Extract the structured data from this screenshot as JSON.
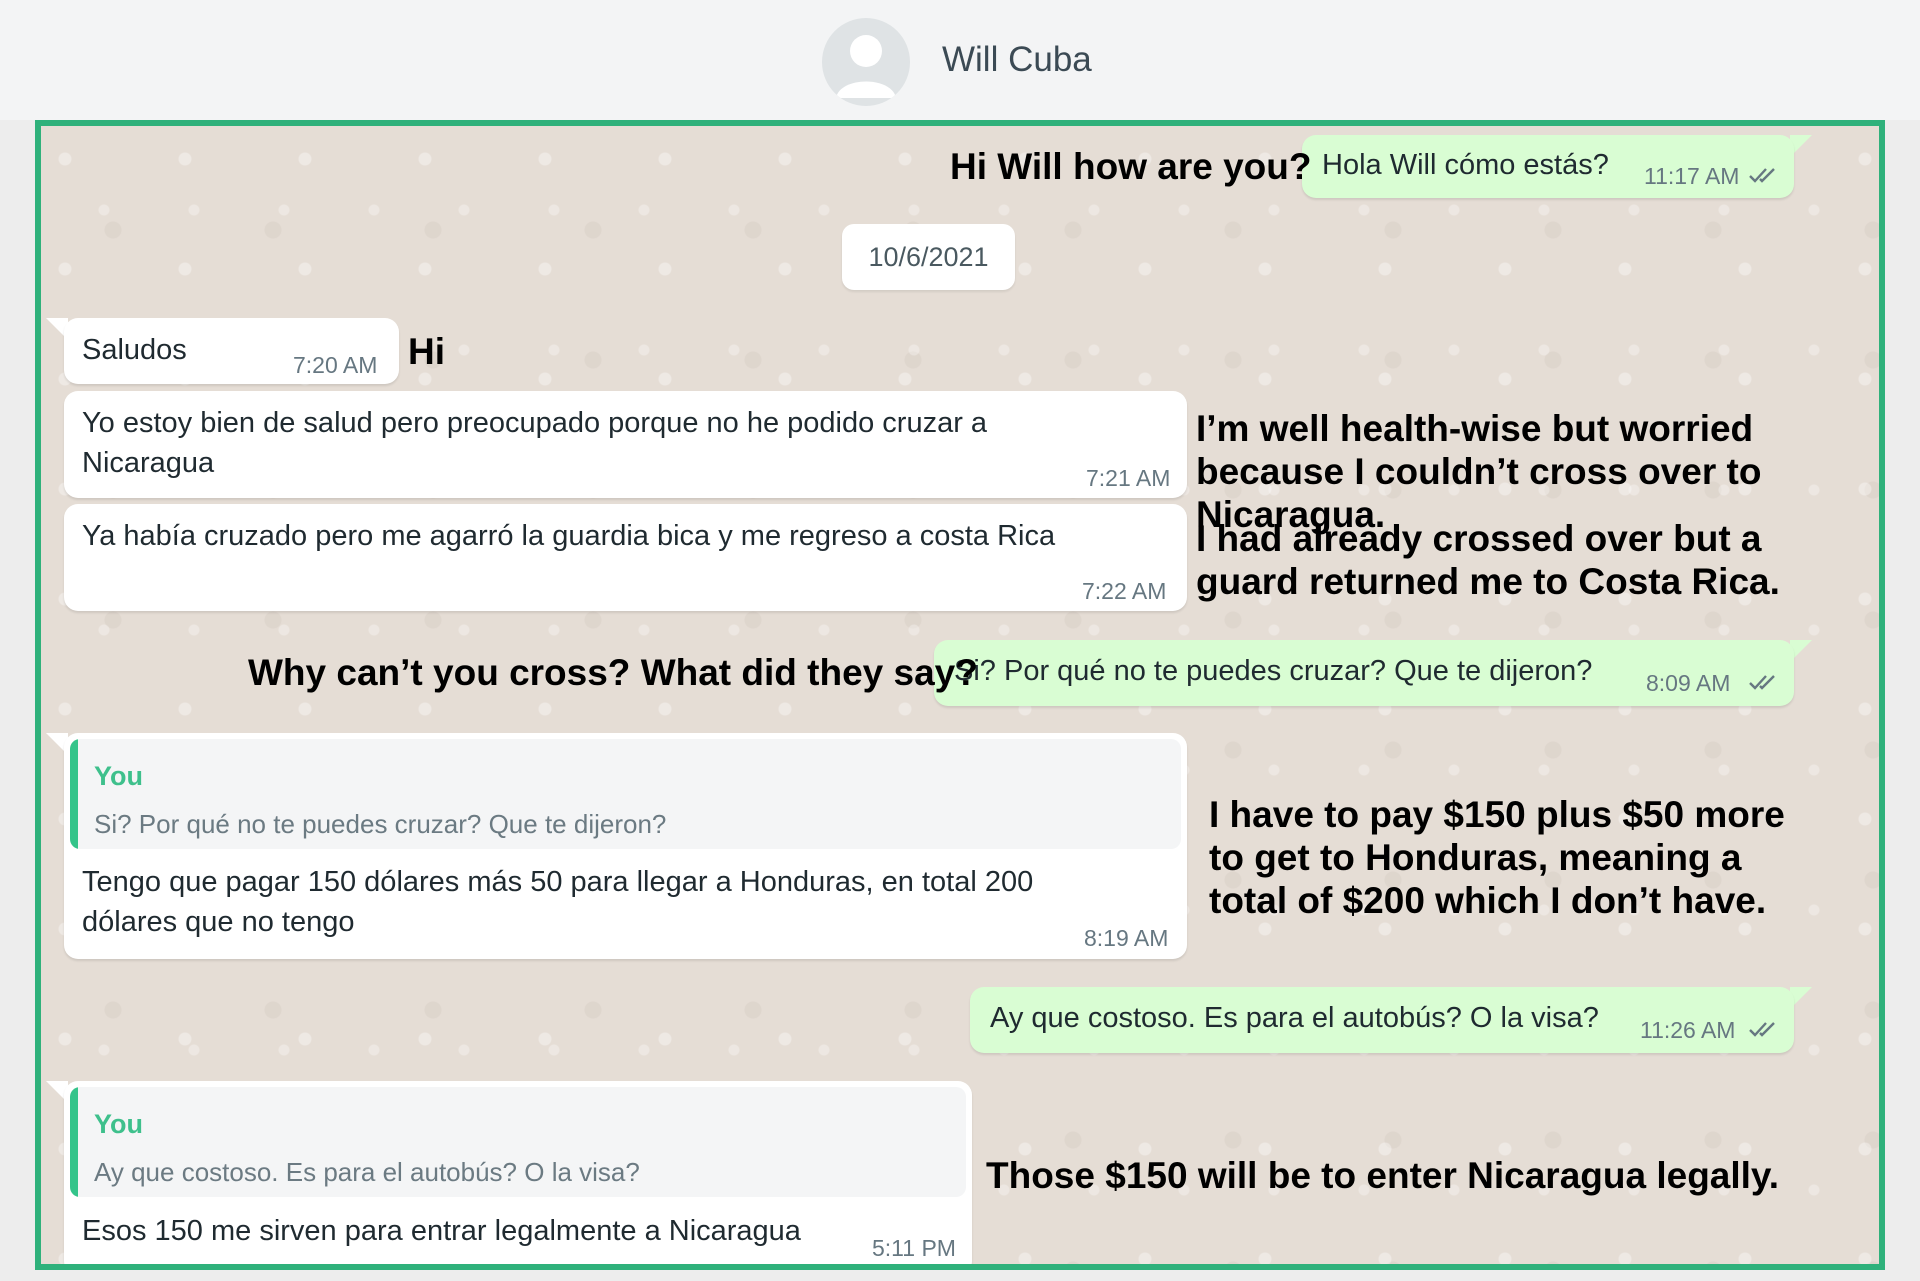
{
  "header": {
    "contact_name": "Will Cuba"
  },
  "date_separator": "10/6/2021",
  "messages": [
    {
      "direction": "outgoing",
      "text": "Hola Will cómo estás?",
      "time": "11:17 AM",
      "status": "read"
    },
    {
      "direction": "incoming",
      "text": "Saludos",
      "time": "7:20 AM"
    },
    {
      "direction": "incoming",
      "text": "Yo estoy bien de salud pero preocupado porque no he podido cruzar a Nicaragua",
      "time": "7:21 AM"
    },
    {
      "direction": "incoming",
      "text": "Ya había cruzado pero me agarró la guardia bica y me regreso a costa Rica",
      "time": "7:22 AM"
    },
    {
      "direction": "outgoing",
      "text": "Si? Por qué no te puedes cruzar? Que te dijeron?",
      "time": "8:09 AM",
      "status": "read"
    },
    {
      "direction": "incoming",
      "quote": {
        "author": "You",
        "text": "Si? Por qué no te puedes cruzar? Que te dijeron?"
      },
      "text": "Tengo que pagar 150 dólares más 50 para llegar a Honduras, en total 200 dólares que no tengo",
      "time": "8:19 AM"
    },
    {
      "direction": "outgoing",
      "text": "Ay que costoso. Es para el autobús? O la visa?",
      "time": "11:26 AM",
      "status": "read"
    },
    {
      "direction": "incoming",
      "quote": {
        "author": "You",
        "text": "Ay que costoso. Es para el autobús? O la visa?"
      },
      "text": "Esos 150 me sirven para entrar legalmente a Nicaragua",
      "time": "5:11 PM"
    }
  ],
  "translations": [
    "Hi Will how are you?",
    "Hi",
    "I’m well health-wise but worried because I couldn’t cross over to Nicaragua.",
    "I had already crossed over but a guard returned me to Costa Rica.",
    "Why can’t you cross? What did they say?",
    "I have to pay $150 plus $50 more to get to Honduras, meaning a total of $200 which I don’t have.",
    "Those $150 will be to enter Nicaragua legally."
  ],
  "colors": {
    "frame_border": "#2fb17b",
    "outgoing_bubble": "#d9fdd3",
    "incoming_bubble": "#ffffff",
    "chat_background": "#e5ddd5",
    "quote_author": "#3ec08c",
    "read_ticks": "#667781"
  },
  "icons": {
    "avatar": "default-person-avatar-icon",
    "status": "double-check-icon"
  }
}
